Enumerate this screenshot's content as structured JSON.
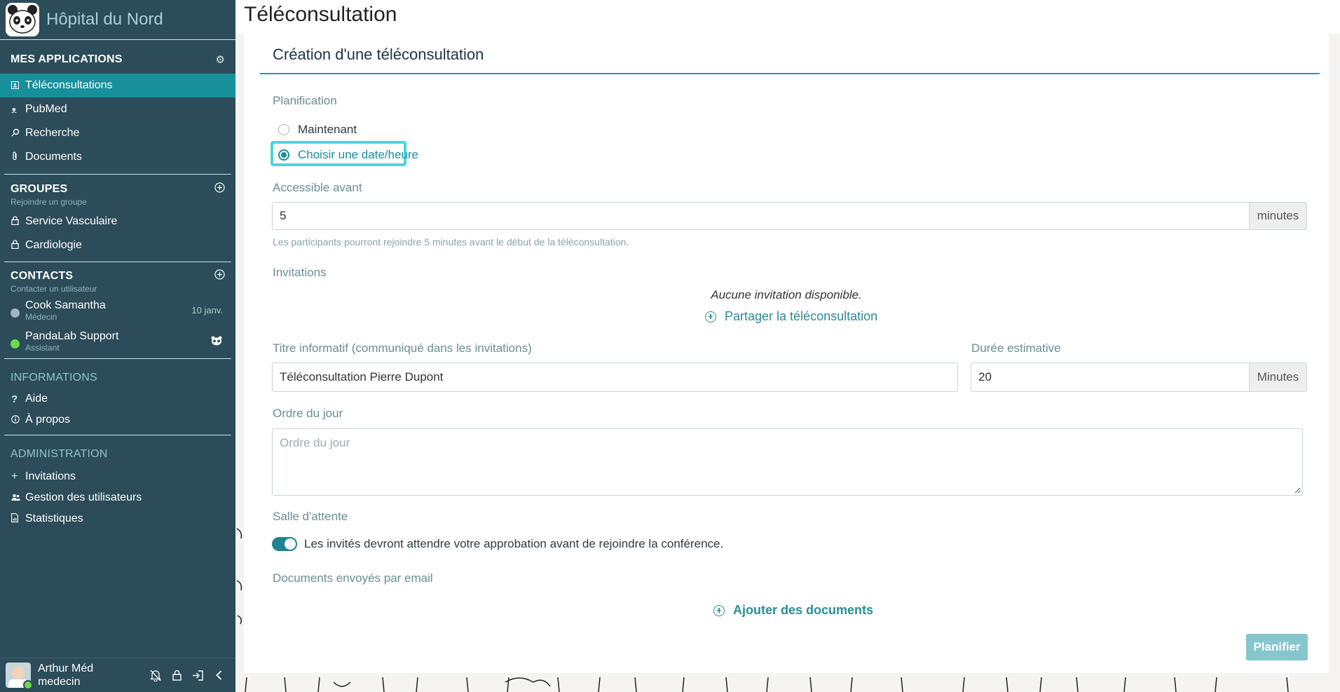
{
  "brand": {
    "title": "Hôpital du Nord"
  },
  "sidebar": {
    "apps_title": "MES APPLICATIONS",
    "apps": [
      {
        "label": "Téléconsultations",
        "icon": "video-icon",
        "active": true
      },
      {
        "label": "PubMed",
        "icon": "pubmed-icon"
      },
      {
        "label": "Recherche",
        "icon": "search-icon"
      },
      {
        "label": "Documents",
        "icon": "paperclip-icon"
      }
    ],
    "groups_title": "GROUPES",
    "groups_sub": "Rejoindre un groupe",
    "groups": [
      {
        "label": "Service Vasculaire",
        "icon": "lock-icon"
      },
      {
        "label": "Cardiologie",
        "icon": "lock-icon"
      }
    ],
    "contacts_title": "CONTACTS",
    "contacts_sub": "Contacter un utilisateur",
    "contacts": [
      {
        "name": "Cook Samantha",
        "role": "Médecin",
        "meta": "10 janv.",
        "status_color": "#9fb7c0"
      },
      {
        "name": "PandaLab Support",
        "role": "Assistant",
        "meta": "",
        "status_color": "#6dd84c"
      }
    ],
    "info_title": "INFORMATIONS",
    "info": [
      {
        "label": "Aide",
        "icon": "question-icon"
      },
      {
        "label": "À propos",
        "icon": "info-icon"
      }
    ],
    "admin_title": "ADMINISTRATION",
    "admin": [
      {
        "label": "Invitations",
        "icon": "plus-icon"
      },
      {
        "label": "Gestion des utilisateurs",
        "icon": "users-icon"
      },
      {
        "label": "Statistiques",
        "icon": "report-icon"
      }
    ],
    "user": {
      "name": "Arthur Méd",
      "role": "medecin"
    }
  },
  "header": {
    "title": "Téléconsultation"
  },
  "form": {
    "card_title": "Création d'une téléconsultation",
    "planning_label": "Planification",
    "radio_now": "Maintenant",
    "radio_choose": "Choisir une date/heure",
    "accessible_label": "Accessible avant",
    "accessible_value": "5",
    "accessible_unit": "minutes",
    "accessible_help": "Les participants pourront rejoindre 5 minutes avant le début de la téléconsultation.",
    "invitations_label": "Invitations",
    "no_invitation": "Aucune invitation disponible.",
    "share_link": "Partager la téléconsultation",
    "title_label": "Titre informatif (communiqué dans les invitations)",
    "title_value": "Téléconsultation Pierre Dupont",
    "duration_label": "Durée estimative",
    "duration_value": "20",
    "duration_unit": "Minutes",
    "agenda_label": "Ordre du jour",
    "agenda_placeholder": "Ordre du jour",
    "waiting_label": "Salle d'attente",
    "waiting_text": "Les invités devront attendre votre approbation avant de rejoindre la conférence.",
    "waiting_enabled": true,
    "docs_label": "Documents envoyés par email",
    "add_docs": "Ajouter des documents",
    "submit": "Planifier"
  },
  "colors": {
    "sidebar_bg": "#2b4c58",
    "active_item": "#17909c",
    "accent": "#2a8d97",
    "focus_ring": "#4fd5df",
    "button_disabled": "#86c6cd"
  }
}
